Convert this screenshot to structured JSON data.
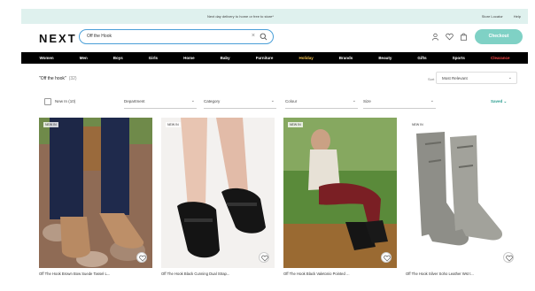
{
  "promo": {
    "text": "Next day delivery to home or free to store*",
    "links": [
      "Store Locator",
      "Help"
    ]
  },
  "header": {
    "logo": "NEXT",
    "search_value": "Off the Hook",
    "clear_label": "×",
    "checkout_label": "Checkout",
    "icons": [
      "account-icon",
      "heart-icon",
      "bag-icon"
    ]
  },
  "nav": {
    "items": [
      "Women",
      "Men",
      "Boys",
      "Girls",
      "Home",
      "Baby",
      "Furniture",
      "Holiday",
      "Brands",
      "Beauty",
      "Gifts",
      "Sports",
      "Clearance"
    ]
  },
  "results": {
    "query": "\"Off the hook\"",
    "count": "(32)"
  },
  "sort": {
    "label": "Sort",
    "value": "Most Relevant"
  },
  "filters": {
    "new_in": "New In (10)",
    "department": "Department",
    "category": "Category",
    "colour": "Colour",
    "size": "Size",
    "saved": "Saved"
  },
  "products": [
    {
      "badge": "NEW IN",
      "title": "Off The Hook Brown Bow Suede Tassel L..."
    },
    {
      "badge": "NEW IN",
      "title": "Off The Hook Black Cunning Dual Strap..."
    },
    {
      "badge": "NEW IN",
      "title": "Off The Hook Black Valetonio Pointed ..."
    },
    {
      "badge": "NEW IN",
      "title": "Off The Hook Silver Soho Leather Wst t..."
    }
  ]
}
